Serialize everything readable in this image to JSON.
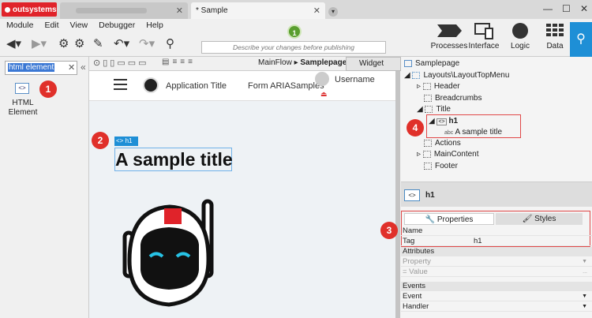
{
  "window": {
    "brand": "outsystems",
    "tabs": [
      {
        "label": ""
      },
      {
        "label": "* Sample"
      }
    ]
  },
  "menubar": [
    "Module",
    "Edit",
    "View",
    "Debugger",
    "Help"
  ],
  "toolbar": {
    "publish_placeholder": "Describe your changes before publishing",
    "publish_number": "1",
    "big_tools": [
      {
        "label": "Processes"
      },
      {
        "label": "Interface"
      },
      {
        "label": "Logic"
      },
      {
        "label": "Data"
      }
    ]
  },
  "left_panel": {
    "search_value": "html element",
    "widget_label": "HTML Element",
    "badge": "1"
  },
  "canvas": {
    "breadcrumb_flow": "MainFlow",
    "breadcrumb_page": "Samplepage",
    "widget_tree_label": "Widget Tree",
    "app_title": "Application Title",
    "form_title": "Form ARIASamples",
    "username": "Username",
    "h1_tag": "h1",
    "h1_text": "A sample title",
    "badge": "2"
  },
  "tree": {
    "root": "Samplepage",
    "layout": "Layouts\\LayoutTopMenu",
    "items": [
      "Header",
      "Breadcrumbs",
      "Title",
      "h1",
      "A sample title",
      "Actions",
      "MainContent",
      "Footer"
    ],
    "badge": "4"
  },
  "properties": {
    "selected": "h1",
    "tabs": [
      "Properties",
      "Styles"
    ],
    "rows": [
      {
        "name": "Name",
        "value": ""
      },
      {
        "name": "Tag",
        "value": "h1"
      }
    ],
    "attributes_header": "Attributes",
    "attr_rows": [
      {
        "name": "Property",
        "value": ""
      },
      {
        "name": "= Value",
        "value": "..."
      }
    ],
    "events_header": "Events",
    "event_rows": [
      {
        "name": "Event"
      },
      {
        "name": "Handler"
      }
    ],
    "badge": "3"
  }
}
